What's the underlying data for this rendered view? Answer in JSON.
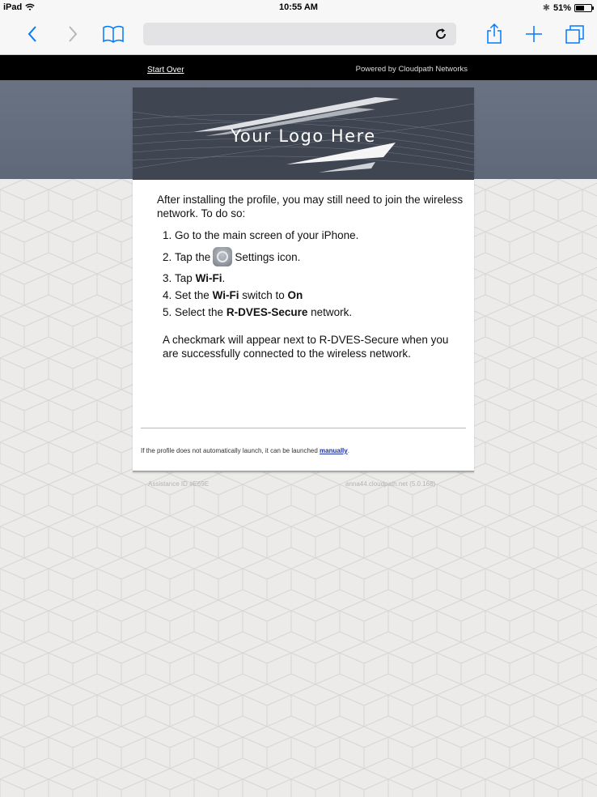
{
  "status_bar": {
    "device": "iPad",
    "time": "10:55 AM",
    "battery": "51%"
  },
  "toolbar": {
    "back_icon": "chevron-left-icon",
    "forward_icon": "chevron-right-icon",
    "bookmarks_icon": "book-icon",
    "reload_icon": "reload-icon",
    "share_icon": "share-icon",
    "new_tab_icon": "plus-icon",
    "tabs_icon": "tabs-icon"
  },
  "header": {
    "start_over": "Start Over",
    "powered_by": "Powered by Cloudpath Networks"
  },
  "logo": {
    "text": "Your Logo Here"
  },
  "instructions": {
    "intro": "After installing the profile, you may still need to join the wireless network. To do so:",
    "steps": [
      {
        "num": "1.",
        "text": "Go to the main screen of your iPhone."
      },
      {
        "num": "2.",
        "pre": "Tap the",
        "post": "Settings icon."
      },
      {
        "num": "3.",
        "pre": "Tap",
        "bold": "Wi-Fi",
        "post": "."
      },
      {
        "num": "4.",
        "pre": "Set the",
        "bold": "Wi-Fi",
        "mid": "switch to",
        "bold2": "On"
      },
      {
        "num": "5.",
        "pre": "Select the",
        "bold": "R-DVES-Secure",
        "post": "network."
      }
    ],
    "checkmark_note": "A checkmark will appear next to R-DVES-Secure when you are successfully connected to the wireless network."
  },
  "footnote": {
    "text": "If the profile does not automatically launch, it can be launched",
    "link": "manually",
    "end": "."
  },
  "meta": {
    "assistance_id": "Assistance ID #E69E",
    "server": "anna44.cloudpath.net (5.0.168)"
  },
  "colors": {
    "accent": "#007aff",
    "band": "#656e7e",
    "logo_bg": "#3f4652",
    "link": "#1a2ea8"
  }
}
